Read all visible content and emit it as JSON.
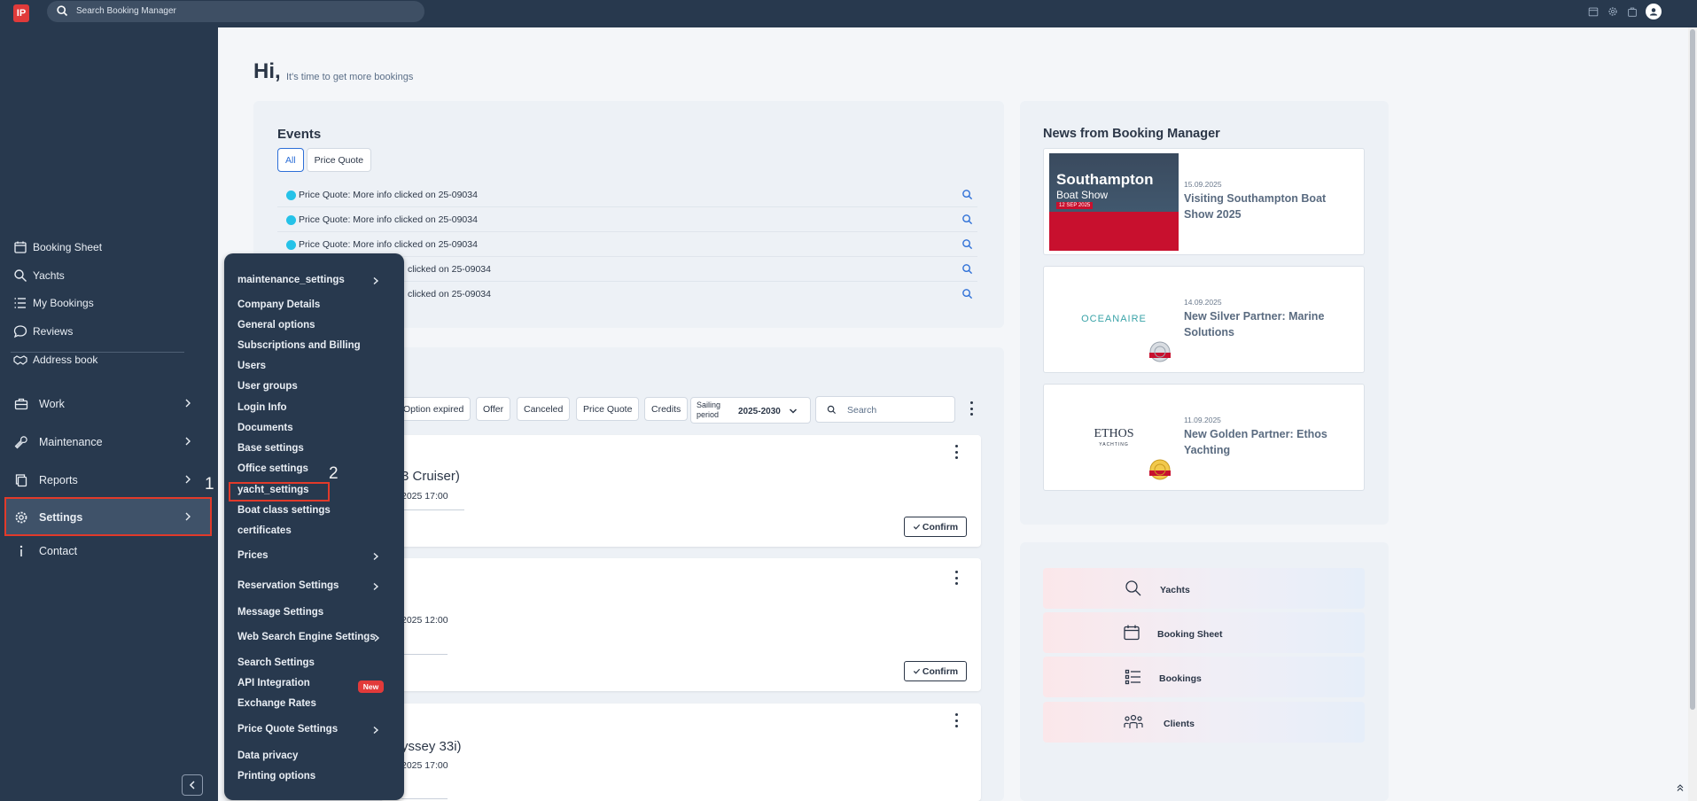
{
  "topbar": {
    "logo_text": "IP",
    "search_placeholder": "Search Booking Manager"
  },
  "sidebar": {
    "items_small": [
      "Booking Sheet",
      "Yachts",
      "My Bookings",
      "Reviews",
      "Address book"
    ],
    "items_big": [
      "Work",
      "Maintenance",
      "Reports",
      "Settings",
      "Contact"
    ],
    "annotation": "1"
  },
  "greeting": {
    "title": "Hi,",
    "subtitle": "It's time to get more bookings"
  },
  "events": {
    "title": "Events",
    "tabs": [
      "All",
      "Price Quote"
    ],
    "rows": [
      "Price Quote: More info clicked on 25-09034",
      "Price Quote: More info clicked on 25-09034",
      "Price Quote: More info clicked on 25-09034",
      "clicked on 25-09034",
      "clicked on 25-09034"
    ]
  },
  "bookings": {
    "filters": [
      "Option expired",
      "Offer",
      "Canceled",
      "Price Quote",
      "Credits"
    ],
    "sailing_label": "Sailing period",
    "sailing_value": "2025-2030",
    "search_placeholder": "Search",
    "cards": [
      {
        "title": "3 Cruiser)",
        "date": "2025 17:00",
        "button": "Confirm"
      },
      {
        "title": "",
        "date": "2025 12:00",
        "button": "Confirm"
      },
      {
        "title": "yssey 33i)",
        "date": "2025 17:00"
      }
    ]
  },
  "news": {
    "title": "News from Booking Manager",
    "items": [
      {
        "date": "15.09.2025",
        "title": "Visiting Southampton Boat Show 2025",
        "img_title": "Southampton",
        "img_sub": "Boat Show",
        "img_date": "12 SEP 2025"
      },
      {
        "date": "14.09.2025",
        "title": "New Silver Partner: Marine Solutions",
        "img_logo": "OCEANAIRE"
      },
      {
        "date": "11.09.2025",
        "title": "New Golden Partner: Ethos Yachting",
        "img_logo": "ETHOS",
        "img_logo_sub": "YACHTING"
      }
    ]
  },
  "quicklinks": [
    "Yachts",
    "Booking Sheet",
    "Bookings",
    "Clients"
  ],
  "settings_menu": {
    "items": [
      "maintenance_settings",
      "Company Details",
      "General options",
      "Subscriptions and Billing",
      "Users",
      "User groups",
      "Login Info",
      "Documents",
      "Base settings",
      "Office settings",
      "yacht_settings",
      "Boat class settings",
      "certificates",
      "Prices",
      "Reservation Settings",
      "Message Settings",
      "Web Search Engine Settings",
      "Search Settings",
      "API Integration",
      "Exchange Rates",
      "Price Quote Settings",
      "Data privacy",
      "Printing options"
    ],
    "new_badge": "New",
    "annotation": "2"
  }
}
